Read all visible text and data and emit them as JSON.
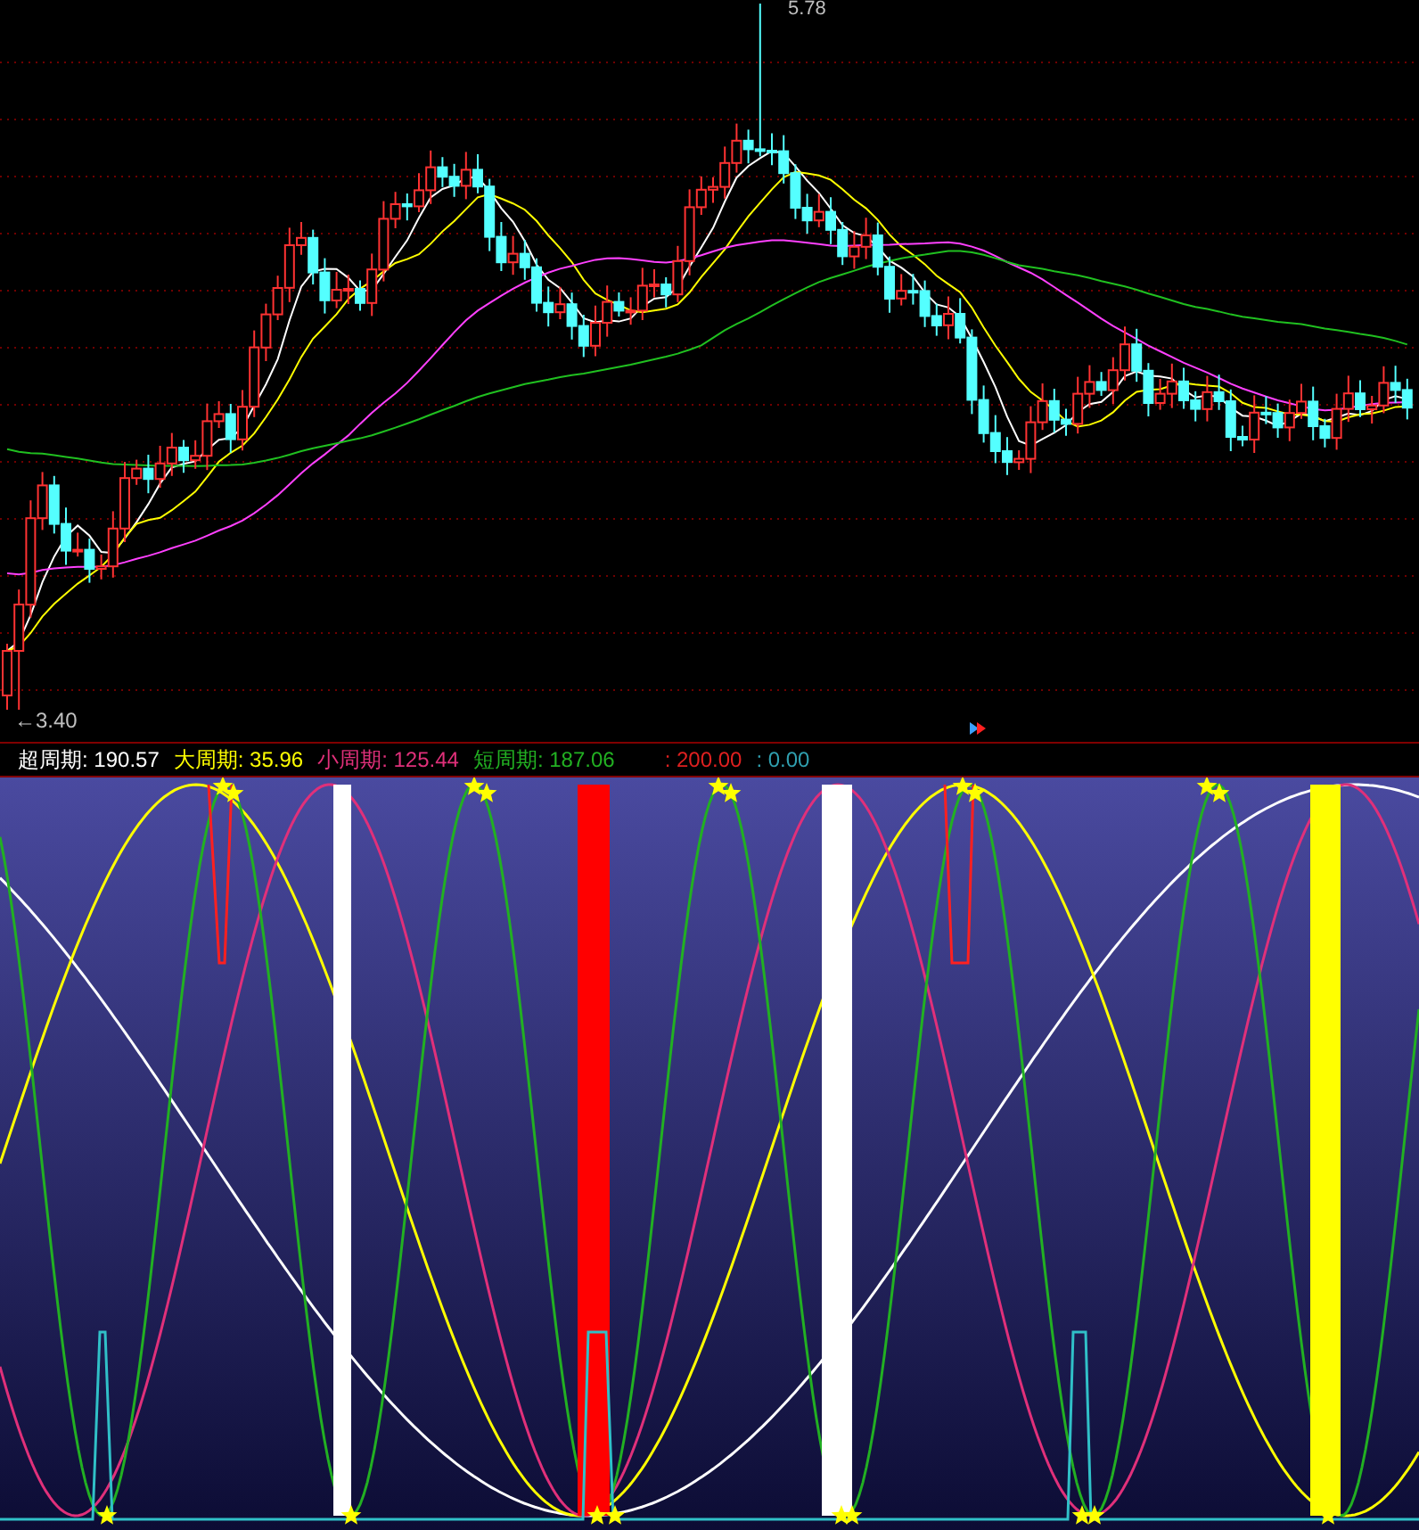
{
  "price_chart": {
    "high_label": "5.78",
    "low_label": "←3.40"
  },
  "indicator_legend": [
    {
      "text": "超周期: 190.57",
      "kind": "super"
    },
    {
      "text": "大周期: 35.96",
      "kind": "major"
    },
    {
      "text": "小周期: 125.44",
      "kind": "minor"
    },
    {
      "text": "短周期: 187.06",
      "kind": "short"
    },
    {
      "text": ": 200.00",
      "kind": "upper"
    },
    {
      "text": ": 0.00",
      "kind": "lower"
    }
  ]
}
